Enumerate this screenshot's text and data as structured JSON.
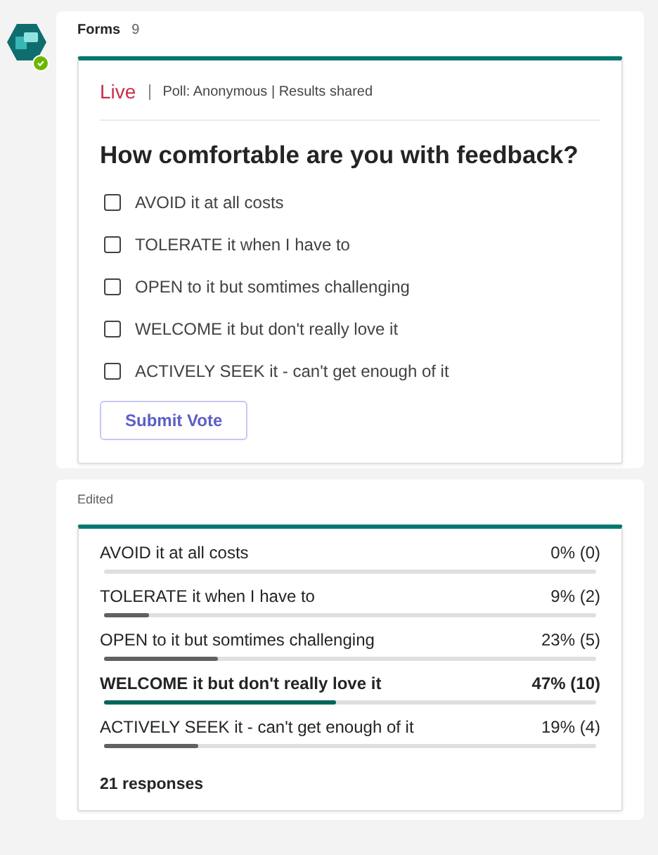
{
  "sender": {
    "name": "Forms",
    "time": "9",
    "online": true
  },
  "poll": {
    "status": "Live",
    "meta": "Poll: Anonymous | Results shared",
    "question": "How comfortable are you with feedback?",
    "options": [
      {
        "label": "AVOID it at all costs",
        "checked": false
      },
      {
        "label": "TOLERATE it when I have to",
        "checked": false
      },
      {
        "label": "OPEN to it but somtimes challenging",
        "checked": false
      },
      {
        "label": "WELCOME it but don't really love it",
        "checked": false
      },
      {
        "label": "ACTIVELY SEEK it - can't get enough of it",
        "checked": false
      }
    ],
    "submit": "Submit Vote"
  },
  "results": {
    "note": "Edited",
    "rows": [
      {
        "label": "AVOID it at all costs",
        "reading": "0% (0)",
        "leading": false
      },
      {
        "label": "TOLERATE it when I have to",
        "reading": "9% (2)",
        "level": 0.09,
        "leading": false
      },
      {
        "label": "OPEN to it but somtimes challenging",
        "reading": "23% (5)",
        "level": 0.23,
        "leading": false
      },
      {
        "label": "WELCOME it but don't really love it",
        "reading": "47% (10)",
        "level": 0.47,
        "leading": true
      },
      {
        "label": "ACTIVELY SEEK it - can't get enough of it",
        "reading": "19% (4)",
        "level": 0.19,
        "leading": false
      }
    ],
    "total": "21 responses"
  }
}
